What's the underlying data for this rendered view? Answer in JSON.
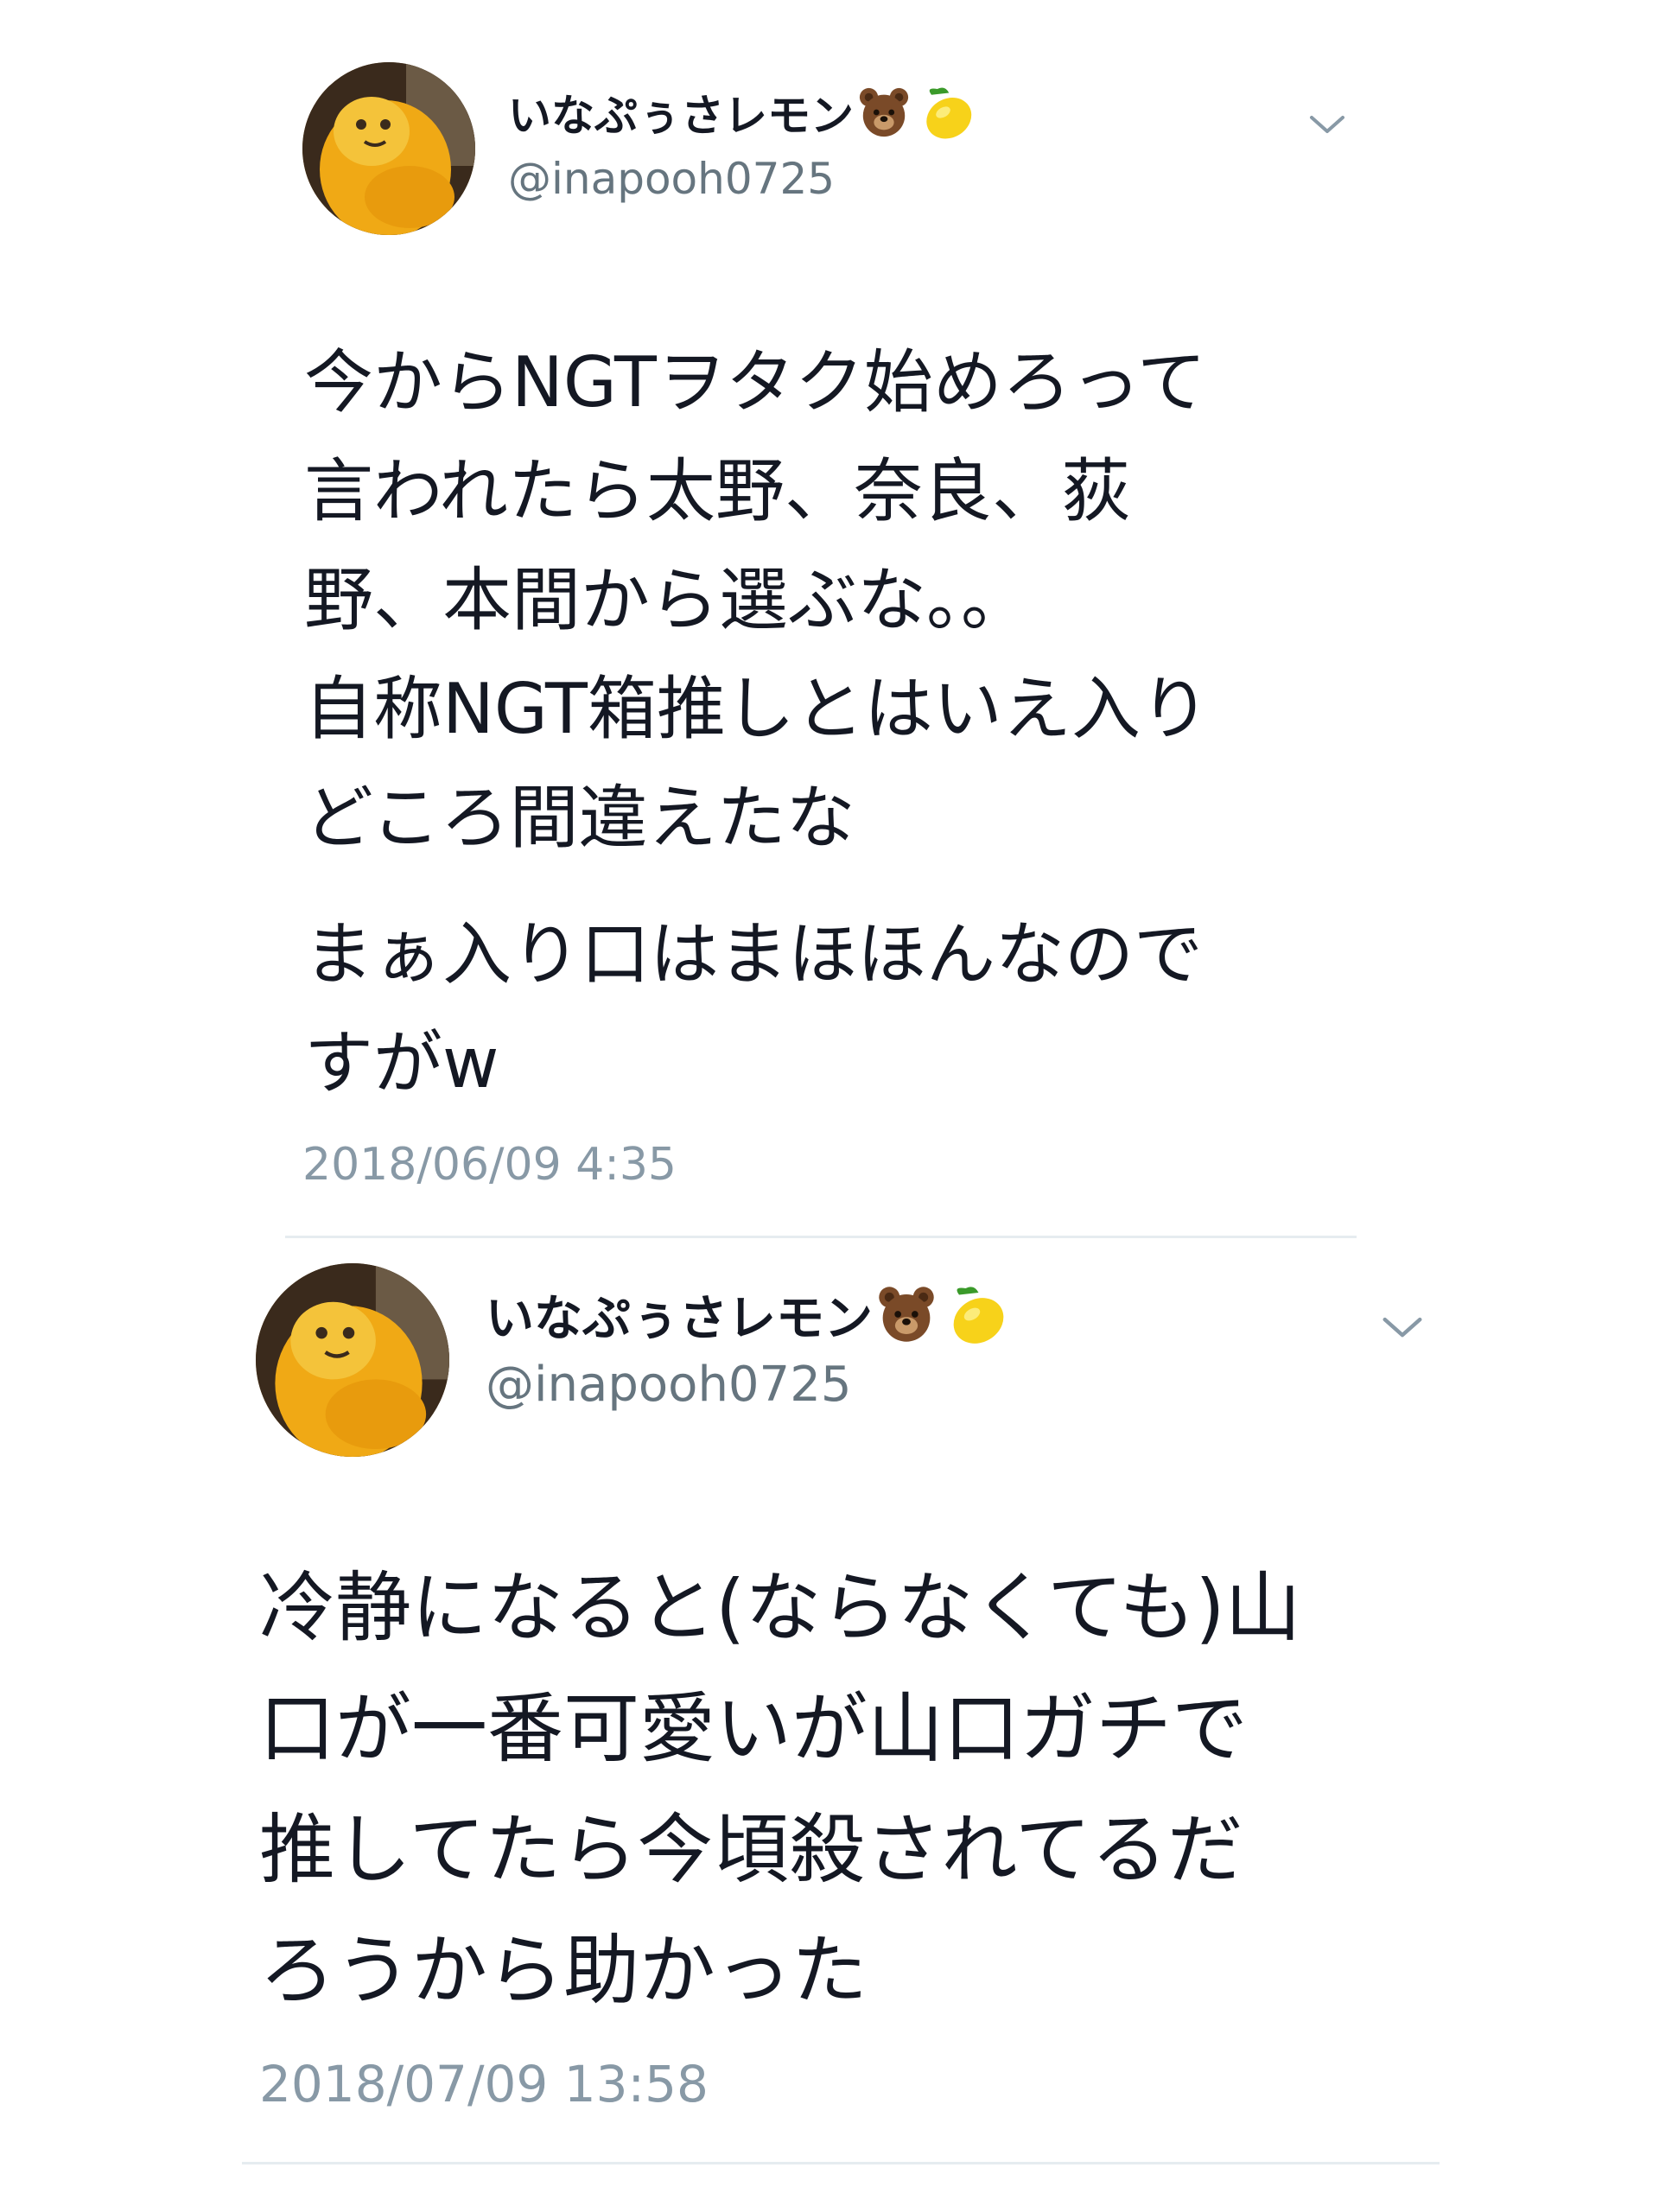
{
  "tweets": [
    {
      "display_name": "いなぷぅさレモン",
      "name_emojis": [
        "bear-icon",
        "lemon-icon"
      ],
      "handle": "@inapooh0725",
      "menu_icon": "chevron-down-icon",
      "lines": [
        "今からNGTヲタク始めろって",
        "言われたら太野、奈良、荻",
        "野、本間から選ぶな。。",
        "自称NGT箱推しとはいえ入り",
        "どころ間違えたな"
      ],
      "lines2": [
        "まぁ入り口はまほほんなので",
        "すがw"
      ],
      "timestamp": "2018/06/09 4:35"
    },
    {
      "display_name": "いなぷぅさレモン",
      "name_emojis": [
        "bear-icon",
        "lemon-icon"
      ],
      "handle": "@inapooh0725",
      "menu_icon": "chevron-down-icon",
      "lines": [
        "冷静になると(ならなくても)山",
        "口が一番可愛いが山口ガチで",
        "推してたら今頃殺されてるだ",
        "ろうから助かった"
      ],
      "timestamp": "2018/07/09 13:58"
    }
  ],
  "colors": {
    "text": "#141823",
    "handle": "#66757f",
    "timestamp": "#8899a6",
    "divider": "#e6ecf0"
  }
}
